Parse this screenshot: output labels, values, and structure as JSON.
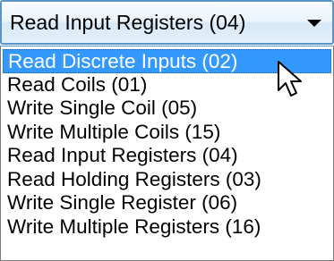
{
  "combo": {
    "value": "Read Input Registers (04)",
    "arrow_icon": "chevron-down-icon"
  },
  "dropdown": {
    "selected_index": 0,
    "options": [
      "Read Discrete Inputs (02)",
      "Read Coils (01)",
      "Write Single Coil (05)",
      "Write Multiple Coils (15)",
      "Read Input Registers (04)",
      "Read Holding Registers (03)",
      "Write Single Register (06)",
      "Write Multiple Registers (16)"
    ]
  },
  "cursor_icon": "mouse-pointer-icon",
  "colors": {
    "highlight": "#3399ff",
    "combo_border": "#5b95c7"
  }
}
